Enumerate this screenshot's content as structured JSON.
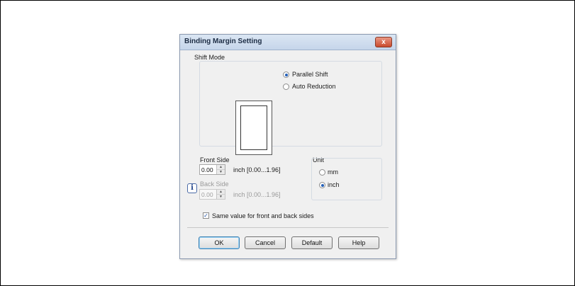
{
  "dialog": {
    "title": "Binding Margin Setting",
    "close_glyph": "x"
  },
  "shift_mode": {
    "label": "Shift Mode",
    "options": [
      {
        "label": "Parallel Shift",
        "selected": true
      },
      {
        "label": "Auto Reduction",
        "selected": false
      }
    ]
  },
  "front_side": {
    "label": "Front Side",
    "value": "0.00",
    "range": "inch [0.00...1.96]"
  },
  "back_side": {
    "label": "Back Side",
    "value": "0.00",
    "range": "inch [0.00...1.96]",
    "disabled": true
  },
  "unit": {
    "label": "Unit",
    "options": [
      {
        "label": "mm",
        "selected": false
      },
      {
        "label": "inch",
        "selected": true
      }
    ]
  },
  "same_value": {
    "label": "Same value for front and back sides",
    "checked": true,
    "check_glyph": "✓"
  },
  "info_glyph": "i",
  "spin_glyphs": {
    "up": "▲",
    "down": "▼"
  },
  "buttons": {
    "ok": "OK",
    "cancel": "Cancel",
    "default": "Default",
    "help": "Help"
  },
  "colors": {
    "selected_radio": "#2560b8",
    "close_button": "#c94a2c"
  }
}
